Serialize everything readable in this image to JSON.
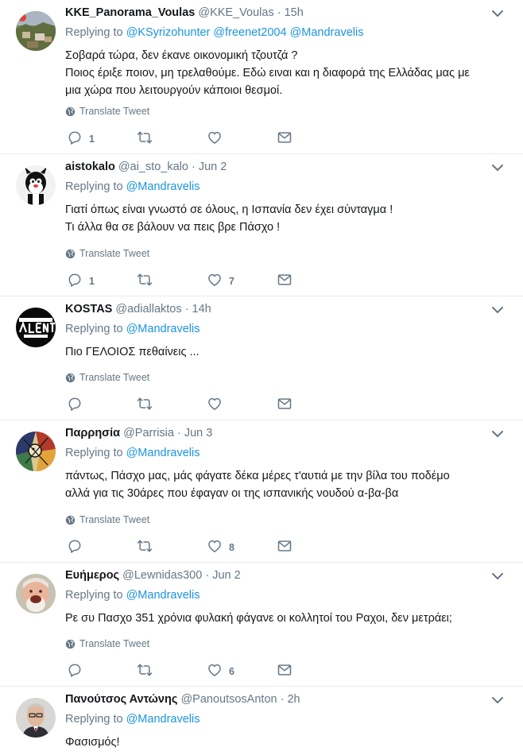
{
  "reply_prefix": "Replying to",
  "translate_label": "Translate Tweet",
  "tweets": [
    {
      "name": "KKE_Panorama_Voulas",
      "handle": "@KKE_Voulas",
      "time": "15h",
      "mentions": [
        "@KSyrizohunter",
        "@freenet2004",
        "@Mandravelis"
      ],
      "lines": [
        "Σοβαρά τώρα, δεν έκανε οικονομική τζουτζά ?",
        "Ποιος έριξε ποιον, μη τρελαθούμε. Εδώ ειναι και η διαφορά της Ελλάδας μας με",
        "μια χώρα που λειτουργούν κάποιοι θεσμοί."
      ],
      "replies": "1",
      "retweets": "",
      "likes": ""
    },
    {
      "name": "aistokalo",
      "handle": "@ai_sto_kalo",
      "time": "Jun 2",
      "mentions": [
        "@Mandravelis"
      ],
      "lines": [
        "Γιατί όπως είναι γνωστό σε όλους, η Ισπανία δεν έχει σύνταγμα !",
        "Τι άλλα θα σε βάλουν να πεις βρε Πάσχο !"
      ],
      "replies": "1",
      "retweets": "",
      "likes": "7"
    },
    {
      "name": "KOSTAS",
      "handle": "@adiallaktos",
      "time": "14h",
      "mentions": [
        "@Mandravelis"
      ],
      "lines": [
        "Πιο ΓΕΛΟΙΟΣ πεθαίνεις ..."
      ],
      "replies": "",
      "retweets": "",
      "likes": ""
    },
    {
      "name": "Παρρησία",
      "handle": "@Parrisia",
      "time": "Jun 3",
      "mentions": [
        "@Mandravelis"
      ],
      "lines": [
        "πάντως, Πάσχο μας, μάς φάγατε δέκα μέρες τ'αυτιά με την βίλα του ποδέμο",
        "αλλά για τις 30άρες που έφαγαν οι της ισπανικής νουδού α-βα-βα"
      ],
      "replies": "",
      "retweets": "",
      "likes": "8"
    },
    {
      "name": "Ευήμερος",
      "handle": "@Lewnidas300",
      "time": "Jun 2",
      "mentions": [
        "@Mandravelis"
      ],
      "lines": [
        "Ρε συ Πασχο 351 χρόνια φυλακή φάγανε οι κολλητοί του Ραχοι, δεν μετράει;"
      ],
      "replies": "",
      "retweets": "",
      "likes": "6"
    },
    {
      "name": "Πανούτσος Αντώνης",
      "handle": "@PanoutsosAnton",
      "time": "2h",
      "mentions": [
        "@Mandravelis"
      ],
      "lines": [
        "Φασισμός!"
      ],
      "replies": "",
      "retweets": "",
      "likes": ""
    }
  ],
  "icons": {
    "reply": "reply-icon",
    "retweet": "retweet-icon",
    "like": "heart-icon",
    "message": "envelope-icon",
    "caret": "chevron-down-icon",
    "translate": "globe-icon"
  },
  "colors": {
    "link": "#1b95e0",
    "secondary_text": "#657786",
    "primary_text": "#14171a",
    "divider": "#e6ecf0"
  }
}
